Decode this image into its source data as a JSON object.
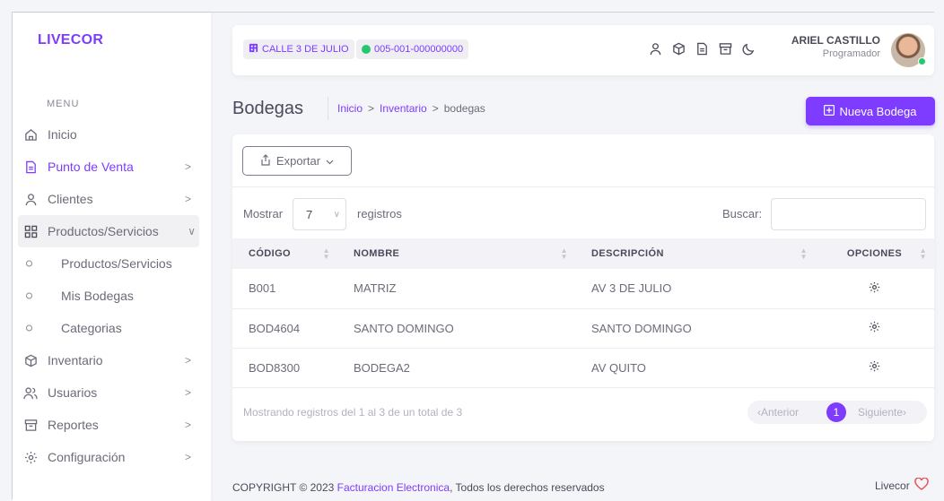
{
  "brand": "LIVECOR",
  "menu_title": "MENU",
  "sidebar": {
    "items": [
      {
        "label": "Inicio",
        "icon": "home-icon"
      },
      {
        "label": "Punto de Venta",
        "icon": "receipt-icon",
        "chevron": ">"
      },
      {
        "label": "Clientes",
        "icon": "user-icon",
        "chevron": ">"
      },
      {
        "label": "Productos/Servicios",
        "icon": "grid-icon",
        "chevron": "∨"
      },
      {
        "label": "Productos/Servicios"
      },
      {
        "label": "Mis Bodegas"
      },
      {
        "label": "Categorias"
      },
      {
        "label": "Inventario",
        "icon": "box-icon",
        "chevron": ">"
      },
      {
        "label": "Usuarios",
        "icon": "users-icon",
        "chevron": ">"
      },
      {
        "label": "Reportes",
        "icon": "archive-icon",
        "chevron": ">"
      },
      {
        "label": "Configuración",
        "icon": "gear-icon",
        "chevron": ">"
      }
    ]
  },
  "topbar": {
    "store": "CALLE 3 DE JULIO",
    "code": "005-001-000000000",
    "user_name": "ARIEL CASTILLO",
    "user_role": "Programador"
  },
  "page": {
    "title": "Bodegas",
    "breadcrumb": [
      "Inicio",
      "Inventario",
      "bodegas"
    ],
    "breadcrumb_sep": ">",
    "new_button": "Nueva Bodega"
  },
  "card": {
    "export_button": "Exportar",
    "show_label": "Mostrar",
    "show_value": "7",
    "records_label": "registros",
    "search_label": "Buscar:",
    "search_value": "",
    "columns": [
      "CÓDIGO",
      "NOMBRE",
      "DESCRIPCIÓN",
      "OPCIONES"
    ],
    "rows": [
      {
        "codigo": "B001",
        "nombre": "MATRIZ",
        "descripcion": "AV 3 DE JULIO"
      },
      {
        "codigo": "BOD4604",
        "nombre": "SANTO DOMINGO",
        "descripcion": "SANTO DOMINGO"
      },
      {
        "codigo": "BOD8300",
        "nombre": "BODEGA2",
        "descripcion": "AV QUITO"
      }
    ],
    "info": "Mostrando registros del 1 al 3 de un total de 3",
    "pager": {
      "prev": "‹Anterior",
      "current": "1",
      "next": "Siguiente›"
    }
  },
  "footer": {
    "copyright_prefix": "COPYRIGHT © 2023",
    "copyright_link": "Facturacion Electronica",
    "copyright_suffix": ", Todos los derechos reservados",
    "right": "Livecor"
  },
  "colors": {
    "accent": "#7d3cff",
    "online": "#28c76f"
  }
}
